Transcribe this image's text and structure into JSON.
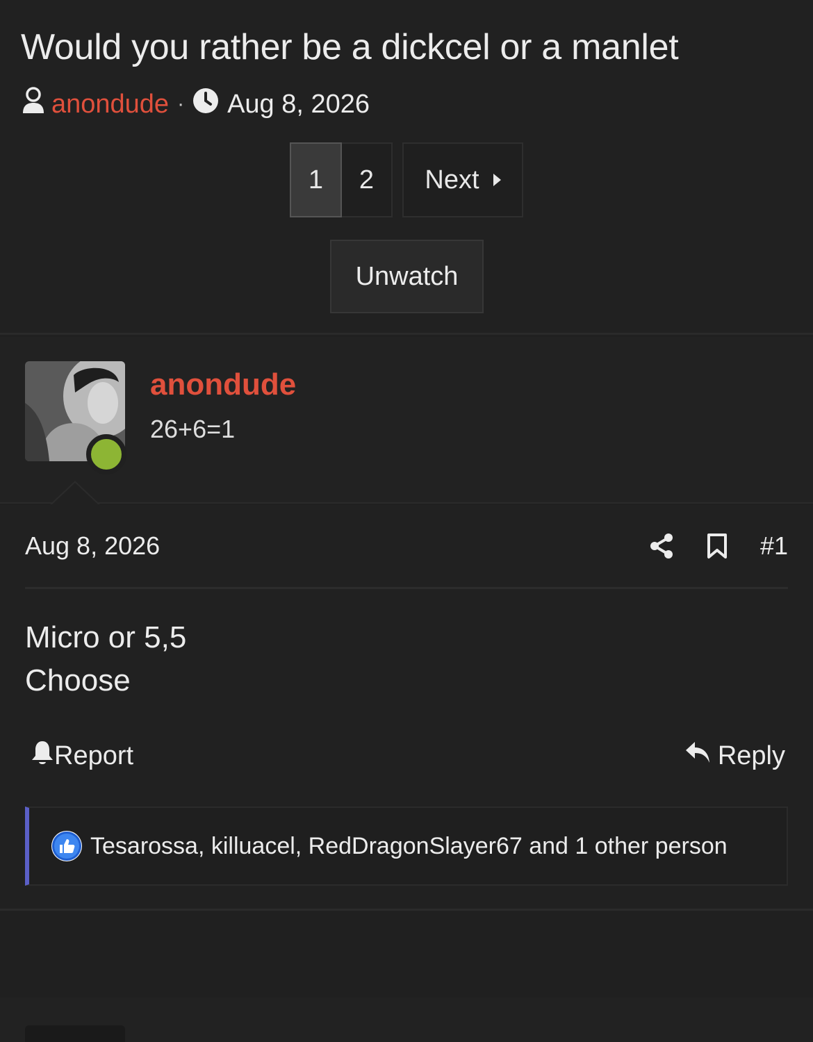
{
  "thread": {
    "title": "Would you rather be a dickcel or a manlet",
    "author": "anondude",
    "separator": "·",
    "date": "Aug 8, 2026"
  },
  "pagination": {
    "current": "1",
    "page2": "2",
    "next_label": "Next"
  },
  "unwatch_label": "Unwatch",
  "post": {
    "username": "anondude",
    "user_title": "26+6=1",
    "date": "Aug 8, 2026",
    "number": "#1",
    "body_lines": [
      "Micro or 5,5",
      "Choose"
    ],
    "report_label": "Report",
    "reply_label": "Reply",
    "reactions_text": "Tesarossa, killuacel, RedDragonSlayer67 and 1 other person",
    "online": true
  },
  "colors": {
    "accent_username": "#e0503c",
    "online_dot": "#8db534",
    "reaction_bar": "#5b5fc7",
    "background": "#202020"
  },
  "icons": [
    "user-icon",
    "clock-icon",
    "share-icon",
    "bookmark-icon",
    "bell-icon",
    "reply-arrow-icon",
    "like-icon",
    "caret-right-icon"
  ]
}
